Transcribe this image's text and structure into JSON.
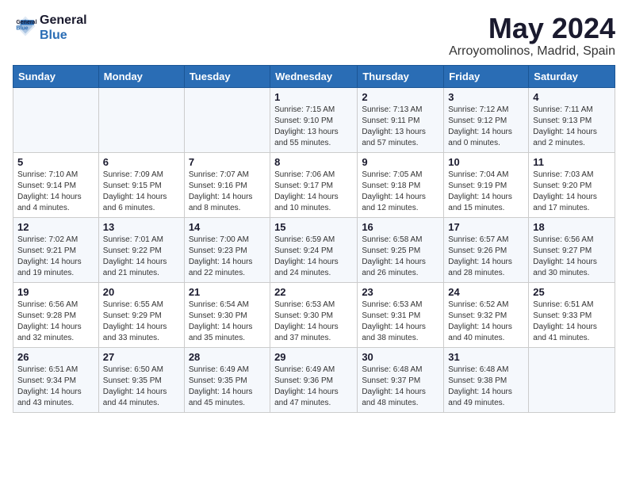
{
  "logo": {
    "line1": "General",
    "line2": "Blue"
  },
  "title": "May 2024",
  "subtitle": "Arroyomolinos, Madrid, Spain",
  "days_of_week": [
    "Sunday",
    "Monday",
    "Tuesday",
    "Wednesday",
    "Thursday",
    "Friday",
    "Saturday"
  ],
  "weeks": [
    [
      {
        "day": "",
        "info": ""
      },
      {
        "day": "",
        "info": ""
      },
      {
        "day": "",
        "info": ""
      },
      {
        "day": "1",
        "info": "Sunrise: 7:15 AM\nSunset: 9:10 PM\nDaylight: 13 hours\nand 55 minutes."
      },
      {
        "day": "2",
        "info": "Sunrise: 7:13 AM\nSunset: 9:11 PM\nDaylight: 13 hours\nand 57 minutes."
      },
      {
        "day": "3",
        "info": "Sunrise: 7:12 AM\nSunset: 9:12 PM\nDaylight: 14 hours\nand 0 minutes."
      },
      {
        "day": "4",
        "info": "Sunrise: 7:11 AM\nSunset: 9:13 PM\nDaylight: 14 hours\nand 2 minutes."
      }
    ],
    [
      {
        "day": "5",
        "info": "Sunrise: 7:10 AM\nSunset: 9:14 PM\nDaylight: 14 hours\nand 4 minutes."
      },
      {
        "day": "6",
        "info": "Sunrise: 7:09 AM\nSunset: 9:15 PM\nDaylight: 14 hours\nand 6 minutes."
      },
      {
        "day": "7",
        "info": "Sunrise: 7:07 AM\nSunset: 9:16 PM\nDaylight: 14 hours\nand 8 minutes."
      },
      {
        "day": "8",
        "info": "Sunrise: 7:06 AM\nSunset: 9:17 PM\nDaylight: 14 hours\nand 10 minutes."
      },
      {
        "day": "9",
        "info": "Sunrise: 7:05 AM\nSunset: 9:18 PM\nDaylight: 14 hours\nand 12 minutes."
      },
      {
        "day": "10",
        "info": "Sunrise: 7:04 AM\nSunset: 9:19 PM\nDaylight: 14 hours\nand 15 minutes."
      },
      {
        "day": "11",
        "info": "Sunrise: 7:03 AM\nSunset: 9:20 PM\nDaylight: 14 hours\nand 17 minutes."
      }
    ],
    [
      {
        "day": "12",
        "info": "Sunrise: 7:02 AM\nSunset: 9:21 PM\nDaylight: 14 hours\nand 19 minutes."
      },
      {
        "day": "13",
        "info": "Sunrise: 7:01 AM\nSunset: 9:22 PM\nDaylight: 14 hours\nand 21 minutes."
      },
      {
        "day": "14",
        "info": "Sunrise: 7:00 AM\nSunset: 9:23 PM\nDaylight: 14 hours\nand 22 minutes."
      },
      {
        "day": "15",
        "info": "Sunrise: 6:59 AM\nSunset: 9:24 PM\nDaylight: 14 hours\nand 24 minutes."
      },
      {
        "day": "16",
        "info": "Sunrise: 6:58 AM\nSunset: 9:25 PM\nDaylight: 14 hours\nand 26 minutes."
      },
      {
        "day": "17",
        "info": "Sunrise: 6:57 AM\nSunset: 9:26 PM\nDaylight: 14 hours\nand 28 minutes."
      },
      {
        "day": "18",
        "info": "Sunrise: 6:56 AM\nSunset: 9:27 PM\nDaylight: 14 hours\nand 30 minutes."
      }
    ],
    [
      {
        "day": "19",
        "info": "Sunrise: 6:56 AM\nSunset: 9:28 PM\nDaylight: 14 hours\nand 32 minutes."
      },
      {
        "day": "20",
        "info": "Sunrise: 6:55 AM\nSunset: 9:29 PM\nDaylight: 14 hours\nand 33 minutes."
      },
      {
        "day": "21",
        "info": "Sunrise: 6:54 AM\nSunset: 9:30 PM\nDaylight: 14 hours\nand 35 minutes."
      },
      {
        "day": "22",
        "info": "Sunrise: 6:53 AM\nSunset: 9:30 PM\nDaylight: 14 hours\nand 37 minutes."
      },
      {
        "day": "23",
        "info": "Sunrise: 6:53 AM\nSunset: 9:31 PM\nDaylight: 14 hours\nand 38 minutes."
      },
      {
        "day": "24",
        "info": "Sunrise: 6:52 AM\nSunset: 9:32 PM\nDaylight: 14 hours\nand 40 minutes."
      },
      {
        "day": "25",
        "info": "Sunrise: 6:51 AM\nSunset: 9:33 PM\nDaylight: 14 hours\nand 41 minutes."
      }
    ],
    [
      {
        "day": "26",
        "info": "Sunrise: 6:51 AM\nSunset: 9:34 PM\nDaylight: 14 hours\nand 43 minutes."
      },
      {
        "day": "27",
        "info": "Sunrise: 6:50 AM\nSunset: 9:35 PM\nDaylight: 14 hours\nand 44 minutes."
      },
      {
        "day": "28",
        "info": "Sunrise: 6:49 AM\nSunset: 9:35 PM\nDaylight: 14 hours\nand 45 minutes."
      },
      {
        "day": "29",
        "info": "Sunrise: 6:49 AM\nSunset: 9:36 PM\nDaylight: 14 hours\nand 47 minutes."
      },
      {
        "day": "30",
        "info": "Sunrise: 6:48 AM\nSunset: 9:37 PM\nDaylight: 14 hours\nand 48 minutes."
      },
      {
        "day": "31",
        "info": "Sunrise: 6:48 AM\nSunset: 9:38 PM\nDaylight: 14 hours\nand 49 minutes."
      },
      {
        "day": "",
        "info": ""
      }
    ]
  ]
}
